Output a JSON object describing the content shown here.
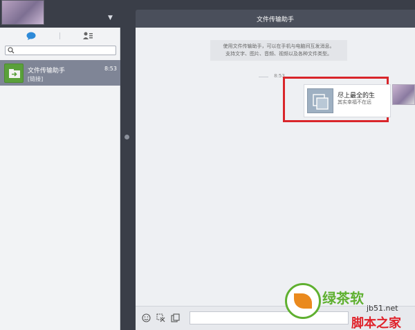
{
  "header": {
    "title": "文件传输助手"
  },
  "search": {
    "placeholder": ""
  },
  "conversations": [
    {
      "name": "文件传输助手",
      "time": "8:53",
      "preview": "[链接]"
    }
  ],
  "chat": {
    "info_lines": [
      "使用文件传输助手，可以在手机与电脑间互发消息。",
      "支持文字、图片、音频、视频以及各种文件类型。"
    ],
    "time_separator": "8:53",
    "message": {
      "title": "尽上最全的生",
      "subtitle": "其实幸福不在远"
    }
  },
  "watermark": {
    "logo_text": "绿茶软",
    "site": "jb51.net",
    "brand": "脚本之家"
  },
  "colors": {
    "accent_selected": "#7f8596",
    "highlight": "#d9252a",
    "header": "#4a4f5b"
  }
}
